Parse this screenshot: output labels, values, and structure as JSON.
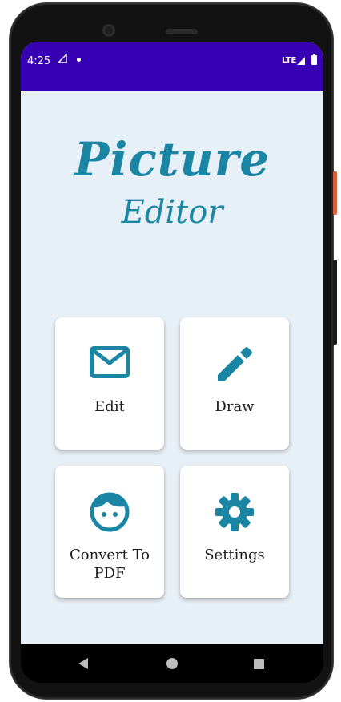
{
  "status_bar": {
    "time": "4:25",
    "network": "LTE",
    "background_color": "#3700b3"
  },
  "app": {
    "title": "Picture",
    "subtitle": "Editor",
    "accent_color": "#1b85a4"
  },
  "menu": [
    {
      "id": "edit",
      "label": "Edit",
      "icon": "mail-icon"
    },
    {
      "id": "draw",
      "label": "Draw",
      "icon": "pencil-icon"
    },
    {
      "id": "pdf",
      "label": "Convert To PDF",
      "icon": "face-icon"
    },
    {
      "id": "settings",
      "label": "Settings",
      "icon": "gear-icon"
    }
  ],
  "nav_bar": {
    "back": "back-icon",
    "home": "home-icon",
    "recents": "recents-icon"
  }
}
